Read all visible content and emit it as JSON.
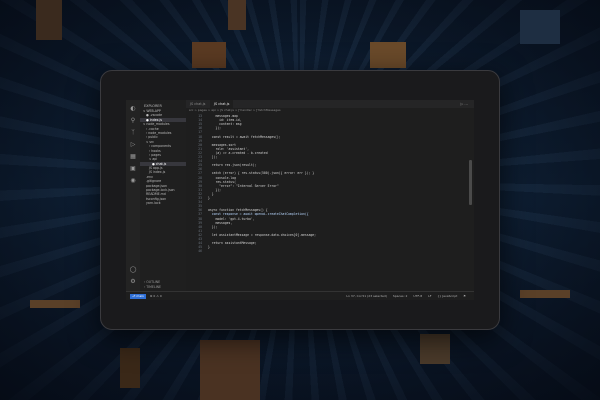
{
  "explorer": {
    "header": "EXPLORER",
    "items": [
      {
        "label": "∨ WEB-APP",
        "indent": 0,
        "selected": false
      },
      {
        "label": "● .vscode",
        "indent": 1,
        "selected": false
      },
      {
        "label": "● index.js",
        "indent": 1,
        "selected": true
      },
      {
        "label": "∨ node_modules",
        "indent": 0,
        "selected": false
      },
      {
        "label": "› .cache",
        "indent": 1,
        "selected": false
      },
      {
        "label": "› node_modules",
        "indent": 1,
        "selected": false
      },
      {
        "label": "› public",
        "indent": 1,
        "selected": false
      },
      {
        "label": "∨ src",
        "indent": 1,
        "selected": false
      },
      {
        "label": "› components",
        "indent": 2,
        "selected": false
      },
      {
        "label": "› hooks",
        "indent": 2,
        "selected": false
      },
      {
        "label": "› pages",
        "indent": 2,
        "selected": false
      },
      {
        "label": "∨ api",
        "indent": 2,
        "selected": false
      },
      {
        "label": "● chat.js",
        "indent": 3,
        "selected": true
      },
      {
        "label": "JS app.js",
        "indent": 2,
        "selected": false
      },
      {
        "label": "JS index.js",
        "indent": 2,
        "selected": false
      },
      {
        "label": ".env",
        "indent": 1,
        "selected": false
      },
      {
        "label": ".gitignore",
        "indent": 1,
        "selected": false
      },
      {
        "label": "package.json",
        "indent": 1,
        "selected": false
      },
      {
        "label": "package-lock.json",
        "indent": 1,
        "selected": false
      },
      {
        "label": "README.md",
        "indent": 1,
        "selected": false
      },
      {
        "label": "tsconfig.json",
        "indent": 1,
        "selected": false
      },
      {
        "label": "yarn.lock",
        "indent": 1,
        "selected": false
      }
    ],
    "outline_label": "› OUTLINE",
    "timeline_label": "› TIMELINE"
  },
  "tabs": [
    {
      "label": "JS chat.js",
      "active": false
    },
    {
      "label": "JS chat.js",
      "active": true
    }
  ],
  "tab_actions": "▷ …",
  "breadcrumb": "src > pages > api > JS chat.js > ƒ handler > ƒ fetchMessages",
  "code_lines": [
    {
      "n": "13",
      "text": "    messages.map",
      "hl": false
    },
    {
      "n": "14",
      "text": "      id: item.id,",
      "hl": false
    },
    {
      "n": "15",
      "text": "      content: msg",
      "hl": false
    },
    {
      "n": "16",
      "text": "    });",
      "hl": false
    },
    {
      "n": "17",
      "text": "",
      "hl": false
    },
    {
      "n": "18",
      "text": "  const result = await fetchMessages();",
      "hl": false
    },
    {
      "n": "19",
      "text": "",
      "hl": false
    },
    {
      "n": "20",
      "text": "  messages.sort",
      "hl": false
    },
    {
      "n": "21",
      "text": "    role: 'assistant',",
      "hl": false
    },
    {
      "n": "22",
      "text": "    (a) => a.created - b.created",
      "hl": false
    },
    {
      "n": "23",
      "text": "  ]);",
      "hl": false
    },
    {
      "n": "24",
      "text": "",
      "hl": false
    },
    {
      "n": "25",
      "text": "  return res.json(result);",
      "hl": false
    },
    {
      "n": "26",
      "text": "",
      "hl": false
    },
    {
      "n": "27",
      "text": "  catch (error) { res.status(500).json({ error: err }); }",
      "hl": false
    },
    {
      "n": "28",
      "text": "    console.log",
      "hl": false
    },
    {
      "n": "29",
      "text": "    res.status(",
      "hl": false
    },
    {
      "n": "30",
      "text": "      \"error\": \"Internal Server Error\"",
      "hl": false
    },
    {
      "n": "31",
      "text": "    });",
      "hl": false
    },
    {
      "n": "32",
      "text": "  }",
      "hl": false
    },
    {
      "n": "33",
      "text": "}",
      "hl": false
    },
    {
      "n": "34",
      "text": "",
      "hl": false
    },
    {
      "n": "35",
      "text": "",
      "hl": false
    },
    {
      "n": "36",
      "text": "async function fetchMessages() {",
      "hl": false
    },
    {
      "n": "37",
      "text": "  const response = await openai.createChatCompletion({",
      "hl": true
    },
    {
      "n": "38",
      "text": "    model: 'gpt-4-turbo',",
      "hl": false
    },
    {
      "n": "39",
      "text": "    messages,",
      "hl": false
    },
    {
      "n": "40",
      "text": "  });",
      "hl": false
    },
    {
      "n": "41",
      "text": "",
      "hl": false
    },
    {
      "n": "42",
      "text": "  let assistantMessage = response.data.choices[0].message;",
      "hl": false
    },
    {
      "n": "43",
      "text": "",
      "hl": false
    },
    {
      "n": "44",
      "text": "  return assistantMessage;",
      "hl": false
    },
    {
      "n": "45",
      "text": "}",
      "hl": false
    },
    {
      "n": "46",
      "text": "",
      "hl": false
    }
  ],
  "status": {
    "branch": "⎇ main",
    "problems": "⊗ 0 ⚠ 0",
    "position": "Ln 37, Col 51 (23 selected)",
    "spaces": "Spaces: 2",
    "encoding": "UTF-8",
    "eol": "LF",
    "language": "{} JavaScript",
    "bell": "⚑"
  },
  "colors": {
    "accent": "#2f6fd6",
    "editor_bg": "#1e1e1e",
    "frame_bg": "#1a1a1c"
  },
  "icons": [
    "explorer-icon",
    "search-icon",
    "source-control-icon",
    "run-debug-icon",
    "extensions-icon",
    "remote-icon",
    "testing-icon",
    "account-icon",
    "settings-gear-icon"
  ]
}
